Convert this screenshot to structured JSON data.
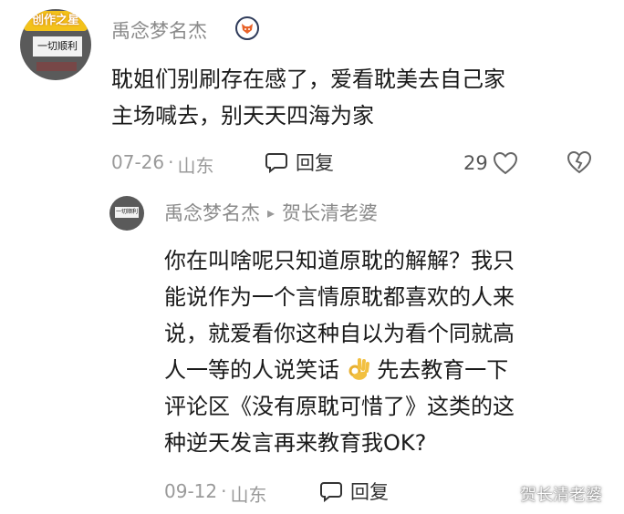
{
  "main_comment": {
    "username": "禹念梦名杰",
    "avatar_banner": "创作之星",
    "avatar_plate": "一切顺利",
    "text_line1": "耽姐们别刷存在感了，爱看耽美去自己家",
    "text_line2": "主场喊去，别天天四海为家",
    "date": "07-26",
    "separator": "·",
    "location": "山东",
    "reply_label": "回复",
    "like_count": "29"
  },
  "reply_comment": {
    "username": "禹念梦名杰",
    "arrow": "▸",
    "reply_to": "贺长清老婆",
    "avatar_plate": "一切顺利",
    "lines": [
      "你在叫啥呢只知道原耽的解解？我只",
      "能说作为一个言情原耽都喜欢的人来",
      "说，就爱看你这种自以为看个同就高",
      "人一等的人说笑话",
      "先去教育一下",
      "评论区《没有原耽可惜了》这类的这",
      "种逆天发言再来教育我OK?"
    ],
    "date": "09-12",
    "separator": "·",
    "location": "山东",
    "reply_label": "回复"
  },
  "watermark": {
    "text": "贺长清老婆"
  },
  "icons": {
    "reply": "speech-bubble-icon",
    "like": "heart-outline-icon",
    "dislike": "broken-heart-icon",
    "badge": "fox-badge-icon",
    "emoji": "ok-hand-emoji"
  }
}
